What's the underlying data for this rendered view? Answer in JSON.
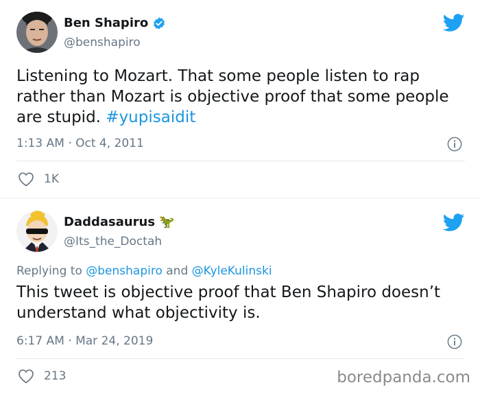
{
  "tweets": [
    {
      "display_name": "Ben Shapiro",
      "verified": true,
      "handle": "@benshapiro",
      "text_prefix": "Listening to Mozart. That some people listen to rap rather than Mozart is objective proof that some people are stupid. ",
      "hashtag": "#yupisaidit",
      "timestamp": "1:13 AM · Oct 4, 2011",
      "likes": "1K",
      "avatar_icon": "person-photo-avatar"
    },
    {
      "display_name": "Daddasaurus",
      "name_emoji": "🦖",
      "handle": "@Its_the_Doctah",
      "reply_prefix": "Replying to ",
      "reply_mention_1": "@benshapiro",
      "reply_and": " and ",
      "reply_mention_2": "@KyleKulinski",
      "text": "This tweet is objective proof that Ben Shapiro doesn’t understand what objectivity is.",
      "timestamp": "6:17 AM · Mar 24, 2019",
      "likes": "213",
      "avatar_icon": "cartoon-sunglasses-avatar"
    }
  ],
  "watermark": "boredpanda.com",
  "colors": {
    "twitter_blue": "#1da1f2",
    "link_blue": "#1b95e0",
    "secondary_text": "#657786",
    "primary_text": "#14171a"
  }
}
